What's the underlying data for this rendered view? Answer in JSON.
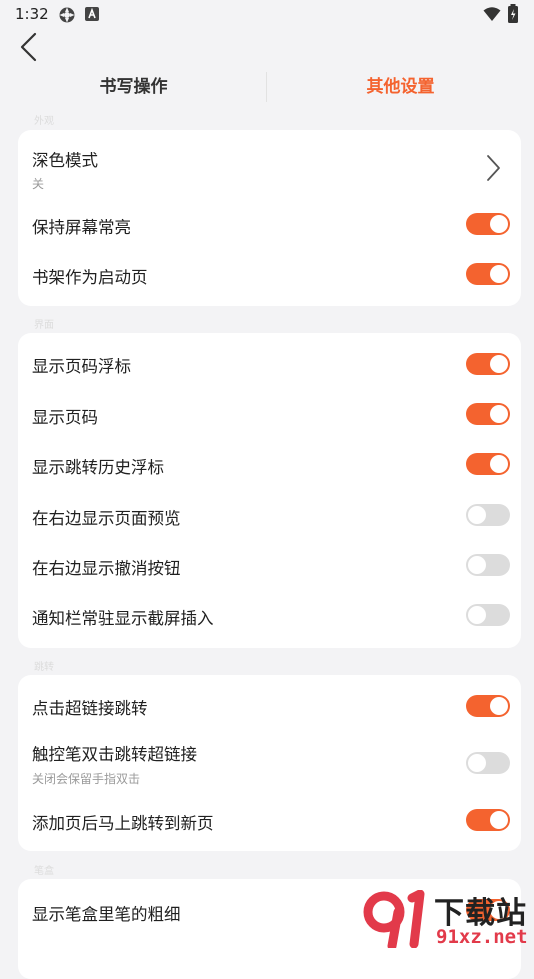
{
  "status_bar": {
    "time": "1:32",
    "left_icons": [
      "sync-icon",
      "a-badge-icon"
    ],
    "right_icons": [
      "wifi-icon",
      "battery-icon"
    ]
  },
  "header": {
    "back_icon": "chevron-left-icon",
    "tabs": [
      {
        "label": "书写操作",
        "active": false
      },
      {
        "label": "其他设置",
        "active": true
      }
    ],
    "accent_color": "#f4632f"
  },
  "sections": [
    {
      "label": "外观",
      "items": [
        {
          "label": "深色模式",
          "sublabel": "关",
          "control": "chevron"
        },
        {
          "label": "保持屏幕常亮",
          "control": "toggle",
          "on": true
        },
        {
          "label": "书架作为启动页",
          "control": "toggle",
          "on": true
        }
      ]
    },
    {
      "label": "界面",
      "items": [
        {
          "label": "显示页码浮标",
          "control": "toggle",
          "on": true
        },
        {
          "label": "显示页码",
          "control": "toggle",
          "on": true
        },
        {
          "label": "显示跳转历史浮标",
          "control": "toggle",
          "on": true
        },
        {
          "label": "在右边显示页面预览",
          "control": "toggle",
          "on": false
        },
        {
          "label": "在右边显示撤消按钮",
          "control": "toggle",
          "on": false
        },
        {
          "label": "通知栏常驻显示截屏插入",
          "control": "toggle",
          "on": false
        }
      ]
    },
    {
      "label": "跳转",
      "items": [
        {
          "label": "点击超链接跳转",
          "control": "toggle",
          "on": true
        },
        {
          "label": "触控笔双击跳转超链接",
          "sublabel": "关闭会保留手指双击",
          "control": "toggle",
          "on": false
        },
        {
          "label": "添加页后马上跳转到新页",
          "control": "toggle",
          "on": true
        }
      ]
    },
    {
      "label": "笔盒",
      "items": [
        {
          "label": "显示笔盒里笔的粗细",
          "control": "toggle",
          "on": true
        }
      ]
    }
  ],
  "watermark": {
    "top": "下载站",
    "bottom": "91xz.net",
    "logo_icon": "91-logo-icon"
  }
}
